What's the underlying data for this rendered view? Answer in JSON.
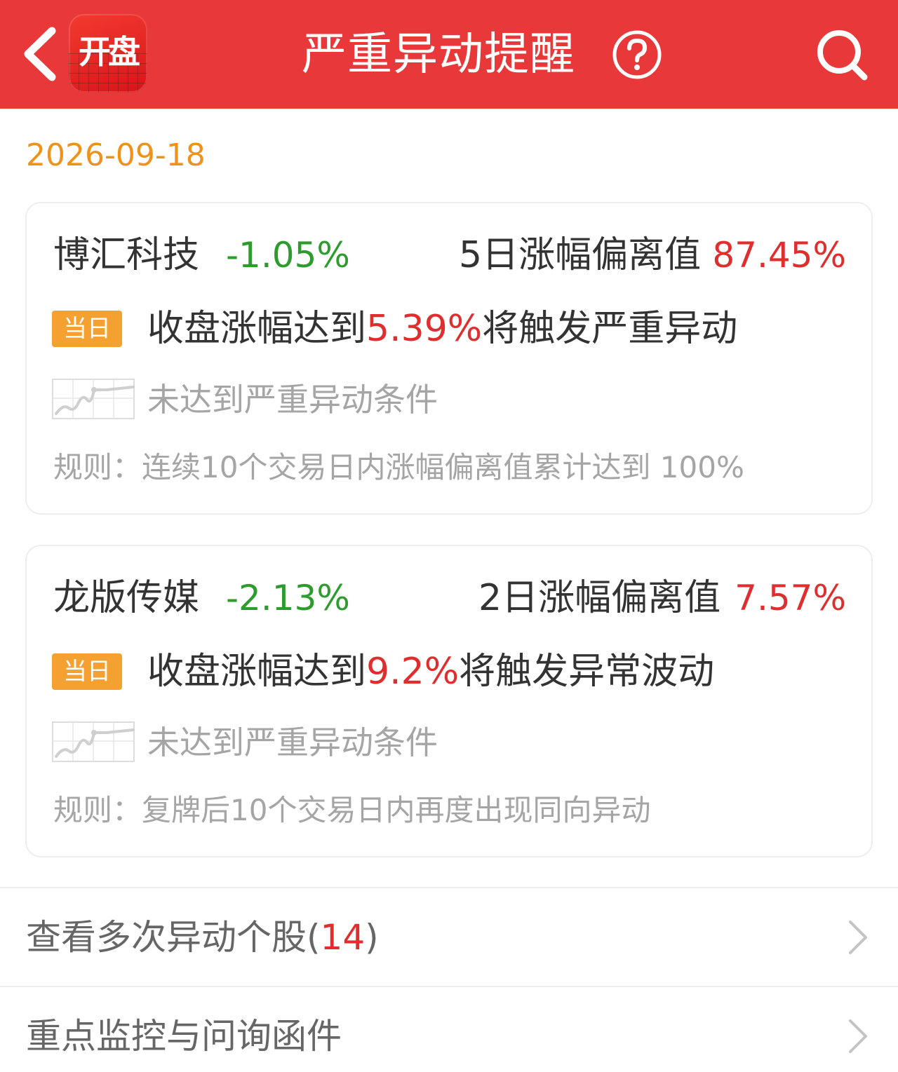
{
  "header": {
    "title": "严重异动提醒",
    "logo_text": "开盘",
    "icons": [
      "back-arrow-icon",
      "help-icon",
      "search-icon"
    ],
    "background_color": "#e8383a"
  },
  "date": "2026-09-18",
  "cards": [
    {
      "name": "博汇科技",
      "change": "-1.05%",
      "deviation_label": "5日涨幅偏离值",
      "deviation_value": "87.45%",
      "badge": "当日",
      "trigger_prefix": "收盘涨幅达到",
      "trigger_value": "5.39%",
      "trigger_suffix": "将触发严重异动",
      "status": "未达到严重异动条件",
      "rule": "规则：连续10个交易日内涨幅偏离值累计达到 100%"
    },
    {
      "name": "龙版传媒",
      "change": "-2.13%",
      "deviation_label": "2日涨幅偏离值",
      "deviation_value": "7.57%",
      "badge": "当日",
      "trigger_prefix": "收盘涨幅达到",
      "trigger_value": "9.2%",
      "trigger_suffix": "将触发异常波动",
      "status": "未达到严重异动条件",
      "rule": "规则：复牌后10个交易日内再度出现同向异动"
    }
  ],
  "links": [
    {
      "label": "查看多次异动个股(",
      "count": "14",
      "label_end": ")"
    },
    {
      "label": "重点监控与问询函件"
    }
  ],
  "colors": {
    "up": "#e02d2d",
    "down": "#2e9b2e",
    "date": "#f0921a",
    "badge": "#f5a131"
  }
}
